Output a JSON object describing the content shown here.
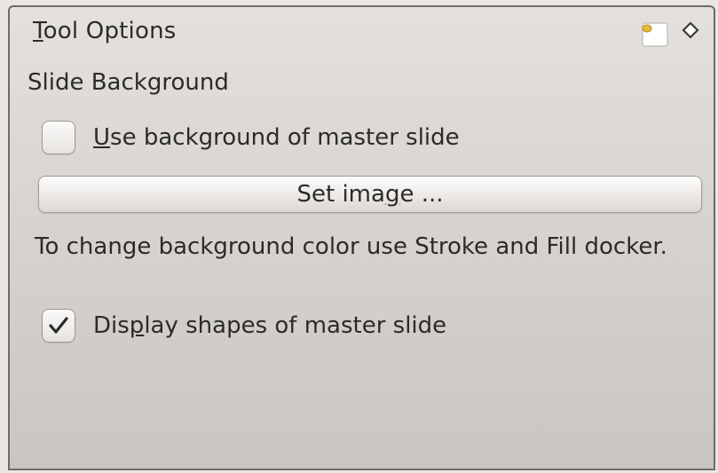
{
  "docker": {
    "title_prefix": "",
    "title_accel": "T",
    "title_rest": "ool Options",
    "float_icon": "float-docker-icon",
    "close_icon": "close-docker-icon"
  },
  "section": {
    "label": "Slide Background"
  },
  "use_master_background": {
    "accel": "U",
    "rest": "se background of master slide",
    "checked": false
  },
  "set_image_button": {
    "pre": "Set ima",
    "accel": "g",
    "post": "e ..."
  },
  "hint": {
    "text": "To change background color use Stroke and Fill docker."
  },
  "display_master_shapes": {
    "pre": "Dis",
    "accel": "p",
    "post": "lay shapes of master slide",
    "checked": true
  },
  "colors": {
    "panel_top": "#e4e1dd",
    "panel_bottom": "#c9c5c0",
    "text": "#2b2b2b",
    "float_accent": "#e8b83a"
  }
}
